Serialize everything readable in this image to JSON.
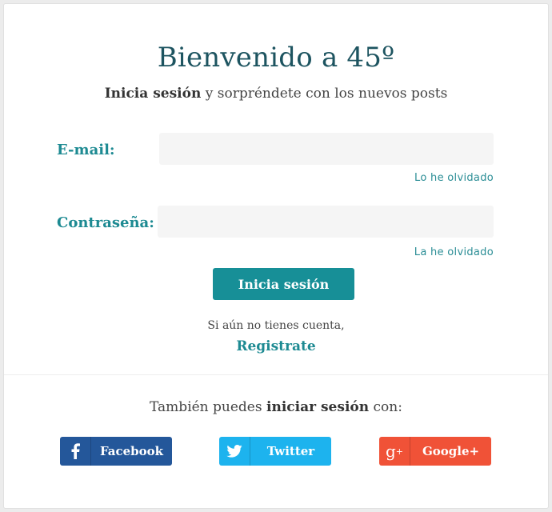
{
  "header": {
    "title": "Bienvenido a 45º",
    "subtitle_bold": "Inicia sesión",
    "subtitle_rest": " y sorpréndete con los nuevos posts"
  },
  "form": {
    "email_label": "E-mail:",
    "email_value": "",
    "email_forgot": "Lo he olvidado",
    "password_label": "Contraseña:",
    "password_value": "",
    "password_forgot": "La he olvidado",
    "submit_label": "Inicia sesión"
  },
  "register": {
    "prompt": "Si aún no tienes cuenta,",
    "link": "Registrate"
  },
  "social": {
    "intro_prefix": "También puedes ",
    "intro_bold": "iniciar sesión",
    "intro_suffix": " con:",
    "buttons": [
      {
        "label": "Facebook",
        "icon": "facebook-icon",
        "color": "#24579a"
      },
      {
        "label": "Twitter",
        "icon": "twitter-icon",
        "color": "#1db3ee"
      },
      {
        "label": "Google+",
        "icon": "google-plus-icon",
        "color": "#f05237"
      }
    ]
  },
  "colors": {
    "title": "#1d5460",
    "accent": "#1d8a92",
    "button": "#178f97",
    "input_bg": "#f5f5f5"
  }
}
